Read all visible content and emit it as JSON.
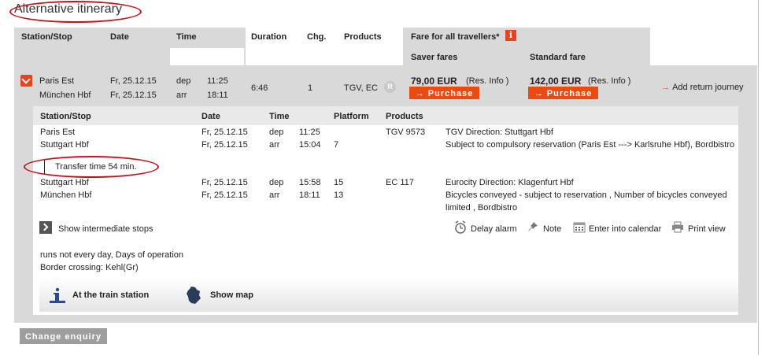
{
  "page": {
    "title": "Alternative itinerary"
  },
  "header": {
    "station_stop": "Station/Stop",
    "date": "Date",
    "time": "Time",
    "duration": "Duration",
    "changes": "Chg.",
    "products": "Products",
    "fare_all": "Fare for all travellers*",
    "saver_fares": "Saver fares",
    "standard_fare": "Standard fare"
  },
  "connection": {
    "from_station": "Paris Est",
    "to_station": "München Hbf",
    "dep_date": "Fr, 25.12.15",
    "arr_date": "Fr, 25.12.15",
    "dep_label": "dep",
    "arr_label": "arr",
    "dep_time": "11:25",
    "arr_time": "18:11",
    "duration": "6:46",
    "changes": "1",
    "products": "TGV, EC",
    "r_badge": "R",
    "saver_price": "79,00 EUR",
    "standard_price": "142,00 EUR",
    "res_info": "(Res. Info )",
    "purchase_label": "Purchase",
    "add_return": "Add return journey"
  },
  "detail": {
    "headers": {
      "station_stop": "Station/Stop",
      "date": "Date",
      "time": "Time",
      "platform": "Platform",
      "products": "Products"
    },
    "leg1": {
      "dep_station": "Paris Est",
      "arr_station": "Stuttgart Hbf",
      "dep_date": "Fr, 25.12.15",
      "arr_date": "Fr, 25.12.15",
      "dep_label": "dep",
      "arr_label": "arr",
      "dep_time": "11:25",
      "arr_time": "15:04",
      "dep_platform": "",
      "arr_platform": "7",
      "product": "TGV 9573",
      "direction": "TGV Direction: Stuttgart Hbf",
      "note": "Subject to compulsory reservation (Paris Est ---> Karlsruhe Hbf), Bordbistro"
    },
    "transfer": "Transfer time 54 min.",
    "leg2": {
      "dep_station": "Stuttgart Hbf",
      "arr_station": "München Hbf",
      "dep_date": "Fr, 25.12.15",
      "arr_date": "Fr, 25.12.15",
      "dep_label": "dep",
      "arr_label": "arr",
      "dep_time": "15:58",
      "arr_time": "18:11",
      "dep_platform": "15",
      "arr_platform": "13",
      "product": "EC 117",
      "direction": "Eurocity Direction: Klagenfurt Hbf",
      "note_line1": "Bicycles conveyed - subject to reservation , Number of bicycles conveyed",
      "note_line2": "limited , Bordbistro"
    },
    "show_intermediate": "Show intermediate stops",
    "tools": {
      "delay_alarm": "Delay alarm",
      "note": "Note",
      "calendar": "Enter into calendar",
      "print": "Print view"
    },
    "operation_note": "runs not every day, Days of operation",
    "border_crossing": "Border crossing: Kehl(Gr)",
    "at_station": "At the train station",
    "show_map": "Show map"
  },
  "footer": {
    "change_enquiry": "Change enquiry"
  }
}
